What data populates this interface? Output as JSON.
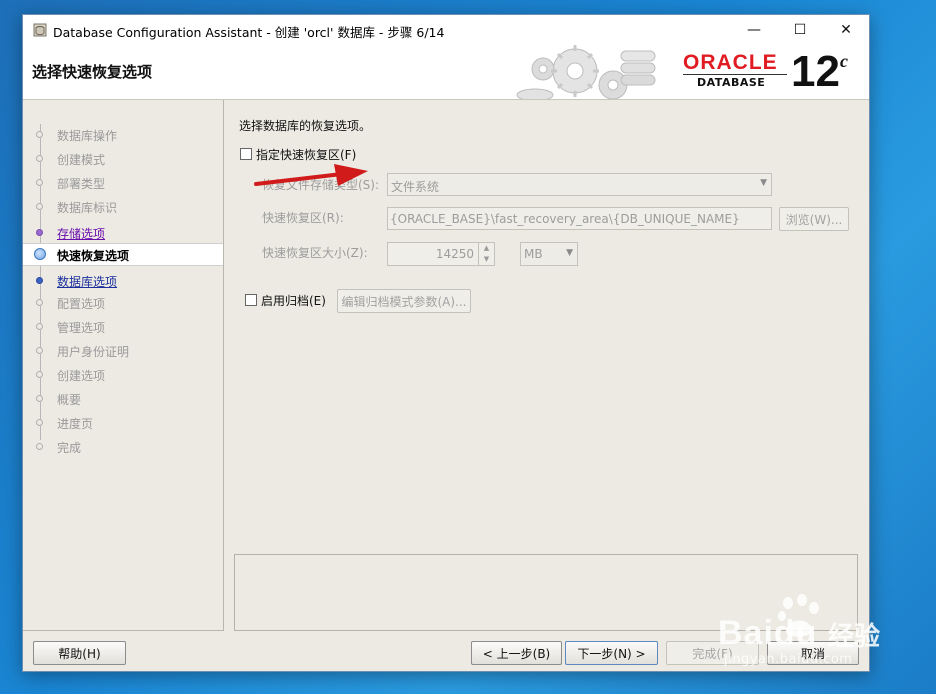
{
  "window": {
    "title": "Database Configuration Assistant - 创建 'orcl' 数据库 - 步骤 6/14",
    "minimize_glyph": "—",
    "maximize_glyph": "☐",
    "close_glyph": "✕"
  },
  "header": {
    "page_title": "选择快速恢复选项",
    "logo_word": "ORACLE",
    "logo_sub": "DATABASE",
    "version": "12",
    "version_suffix": "c",
    "logo_color": "#e11b22"
  },
  "sidebar": {
    "steps": [
      {
        "label": "数据库操作",
        "state": "disabled"
      },
      {
        "label": "创建模式",
        "state": "disabled"
      },
      {
        "label": "部署类型",
        "state": "disabled"
      },
      {
        "label": "数据库标识",
        "state": "disabled"
      },
      {
        "label": "存储选项",
        "state": "visited"
      },
      {
        "label": "快速恢复选项",
        "state": "current"
      },
      {
        "label": "数据库选项",
        "state": "link"
      },
      {
        "label": "配置选项",
        "state": "disabled"
      },
      {
        "label": "管理选项",
        "state": "disabled"
      },
      {
        "label": "用户身份证明",
        "state": "disabled"
      },
      {
        "label": "创建选项",
        "state": "disabled"
      },
      {
        "label": "概要",
        "state": "disabled"
      },
      {
        "label": "进度页",
        "state": "disabled"
      },
      {
        "label": "完成",
        "state": "disabled"
      }
    ]
  },
  "main": {
    "intro": "选择数据库的恢复选项。",
    "fra_checkbox_label": "指定快速恢复区(F)",
    "fra_checked": false,
    "storage_type_label": "恢复文件存储类型(S):",
    "storage_type_value": "文件系统",
    "fra_location_label": "快速恢复区(R):",
    "fra_location_value": "{ORACLE_BASE}\\fast_recovery_area\\{DB_UNIQUE_NAME}",
    "browse_button": "浏览(W)...",
    "fra_size_label": "快速恢复区大小(Z):",
    "fra_size_value": "14250",
    "fra_size_unit": "MB",
    "archive_checkbox_label": "启用归档(E)",
    "archive_checked": false,
    "archive_params_button": "编辑归档模式参数(A)..."
  },
  "footer": {
    "help": "帮助(H)",
    "back": "< 上一步(B)",
    "next": "下一步(N) >",
    "finish": "完成(F)",
    "cancel": "取消"
  },
  "watermark": {
    "brand": "Baidu",
    "brand_cn": "经验",
    "url": "jingyan.baidu.com"
  }
}
